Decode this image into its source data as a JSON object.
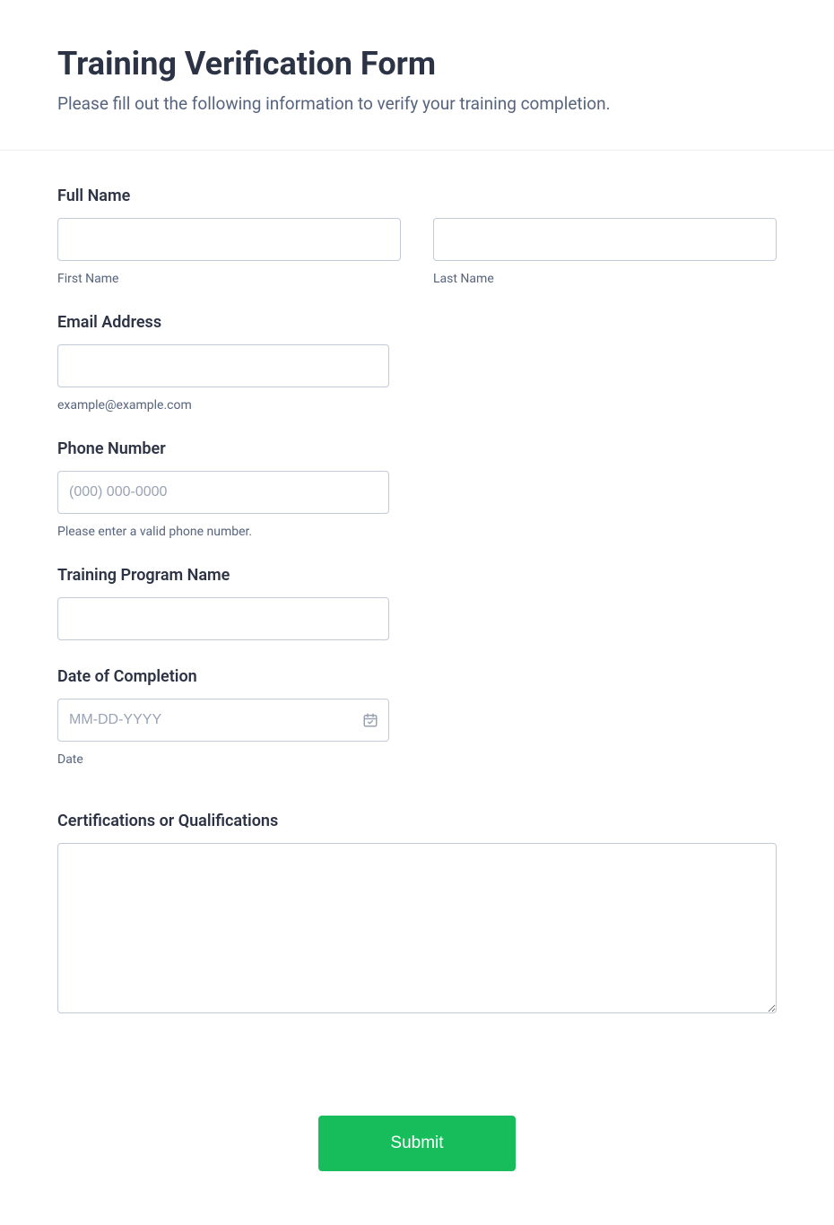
{
  "header": {
    "title": "Training Verification Form",
    "subtitle": "Please fill out the following information to verify your training completion."
  },
  "fields": {
    "full_name": {
      "label": "Full Name",
      "first_sub": "First Name",
      "last_sub": "Last Name"
    },
    "email": {
      "label": "Email Address",
      "sub": "example@example.com"
    },
    "phone": {
      "label": "Phone Number",
      "placeholder": "(000) 000-0000",
      "sub": "Please enter a valid phone number."
    },
    "program": {
      "label": "Training Program Name"
    },
    "completion": {
      "label": "Date of Completion",
      "placeholder": "MM-DD-YYYY",
      "sub": "Date"
    },
    "certs": {
      "label": "Certifications or Qualifications"
    }
  },
  "submit": {
    "label": "Submit"
  }
}
